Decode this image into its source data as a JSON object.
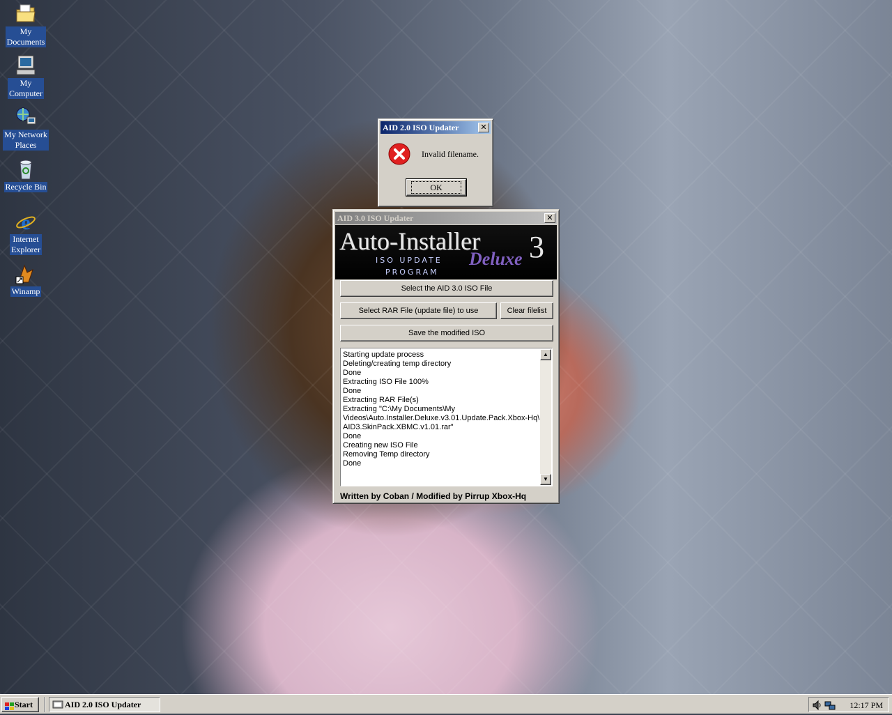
{
  "desktop": {
    "icons": [
      {
        "label_line1": "My",
        "label_line2": "Documents",
        "icon": "folder-documents-icon"
      },
      {
        "label_line1": "My",
        "label_line2": "Computer",
        "icon": "computer-icon"
      },
      {
        "label_line1": "My Network",
        "label_line2": "Places",
        "icon": "network-icon"
      },
      {
        "label_line1": "Recycle Bin",
        "label_line2": "",
        "icon": "recycle-bin-icon"
      },
      {
        "label_line1": "Internet",
        "label_line2": "Explorer",
        "icon": "internet-explorer-icon"
      },
      {
        "label_line1": "Winamp",
        "label_line2": "",
        "icon": "winamp-icon"
      }
    ]
  },
  "dialog": {
    "title": "AID 2.0 ISO Updater",
    "message": "Invalid filename.",
    "ok_label": "OK",
    "icon": "error-icon"
  },
  "main_window": {
    "title": "AID 3.0 ISO Updater",
    "banner": {
      "title": "Auto-Installer",
      "number": "3",
      "deluxe": "Deluxe",
      "line1": "ISO UPDATE",
      "line2": "PROGRAM"
    },
    "select_iso_label": "Select the AID 3.0 ISO File",
    "select_rar_label": "Select RAR File (update file) to use",
    "clear_label": "Clear filelist",
    "save_label": "Save the modified ISO",
    "log": [
      "Starting update process",
      "Deleting/creating temp directory",
      "Done",
      "Extracting ISO File 100%",
      "Done",
      "Extracting RAR File(s)",
      "Extracting \"C:\\My Documents\\My",
      "Videos\\Auto.Installer.Deluxe.v3.01.Update.Pack.Xbox-Hq\\",
      "AID3.SkinPack.XBMC.v1.01.rar\"",
      "Done",
      "Creating new ISO File",
      "Removing Temp directory",
      "Done"
    ],
    "footer": "Written by Coban / Modified by Pirrup Xbox-Hq"
  },
  "taskbar": {
    "start_label": "Start",
    "task_label": "AID 2.0 ISO Updater",
    "clock": "12:17 PM"
  },
  "colors": {
    "titlebar_active": "#0a246a",
    "desktop_label_bg": "#264e94",
    "error_red": "#e02020"
  }
}
